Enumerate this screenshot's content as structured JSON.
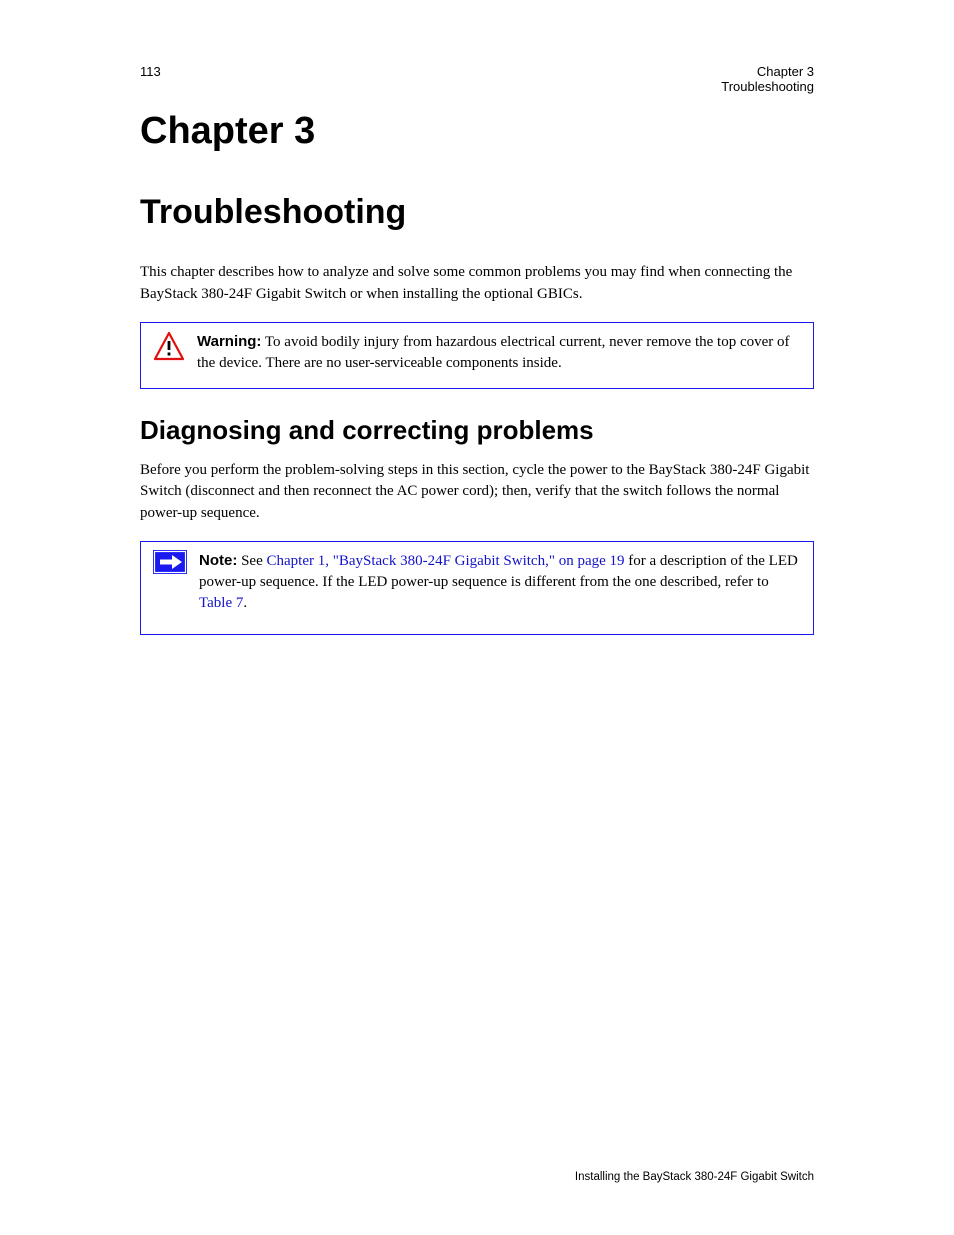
{
  "header": {
    "page_number": "113",
    "chapter_line1": "Chapter 3",
    "chapter_line2": "Troubleshooting"
  },
  "chapter": {
    "number": "Chapter 3",
    "title": "Troubleshooting"
  },
  "intro": "This chapter describes how to analyze and solve some common problems you may find when connecting the BayStack 380-24F Gigabit Switch or when installing the optional GBICs.",
  "warning": {
    "label": "Warning:",
    "text": "To avoid bodily injury from hazardous electrical current, never remove the top cover of the device. There are no user-serviceable components inside."
  },
  "section": {
    "title": "Diagnosing and correcting problems",
    "body1": "Before you perform the problem-solving steps in this section, cycle the power to the BayStack 380-24F Gigabit Switch (disconnect and then reconnect the AC power cord); then, verify that the switch follows the normal power-up sequence.",
    "note_label": "Note:",
    "note_text_1": "See ",
    "note_link": "Chapter 1, \"BayStack 380-24F Gigabit Switch,\" on page 19",
    "note_text_2": " for a description of the LED power-up sequence. If the LED power-up sequence is different from the one described, refer to ",
    "note_xref": "Table 7",
    "note_text_3": "."
  },
  "footer": {
    "left": "",
    "right": "Installing the BayStack 380-24F Gigabit Switch"
  }
}
